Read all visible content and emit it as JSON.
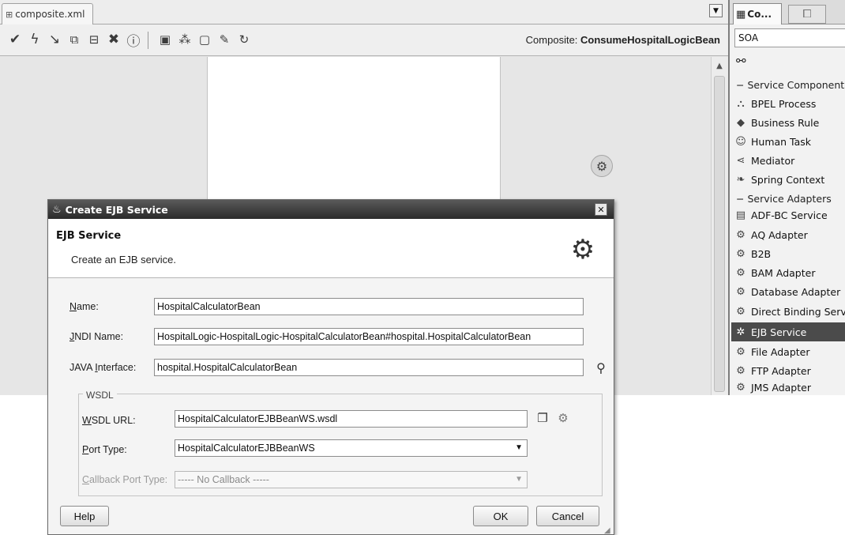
{
  "editor": {
    "tab_label": "composite.xml",
    "composite_prefix": "Composite:",
    "composite_name": "ConsumeHospitalLogicBean"
  },
  "toolbar": {
    "icons": [
      "validate-icon",
      "lightning-icon",
      "wire-icon",
      "copy-icon",
      "paste-icon",
      "delete-icon",
      "info-icon",
      "layout-icon",
      "tree-icon",
      "deploy-icon",
      "edit-icon",
      "test-icon"
    ]
  },
  "palette": {
    "tab_label": "Co...",
    "category_value": "SOA",
    "group_components": "− Service Components",
    "components": [
      {
        "label": "BPEL Process",
        "icon": "bpel-icon"
      },
      {
        "label": "Business Rule",
        "icon": "rule-icon"
      },
      {
        "label": "Human Task",
        "icon": "human-task-icon"
      },
      {
        "label": "Mediator",
        "icon": "mediator-icon"
      },
      {
        "label": "Spring Context",
        "icon": "spring-icon"
      }
    ],
    "group_adapters": "− Service Adapters",
    "adapters": [
      {
        "label": "ADF-BC Service",
        "icon": "adf-icon"
      },
      {
        "label": "AQ Adapter",
        "icon": "aq-icon"
      },
      {
        "label": "B2B",
        "icon": "b2b-icon"
      },
      {
        "label": "BAM Adapter",
        "icon": "bam-icon"
      },
      {
        "label": "Database Adapter",
        "icon": "database-icon"
      },
      {
        "label": "Direct Binding Serv",
        "icon": "binding-icon"
      },
      {
        "label": "EJB Service",
        "icon": "ejb-icon"
      },
      {
        "label": "File Adapter",
        "icon": "file-icon"
      },
      {
        "label": "FTP Adapter",
        "icon": "ftp-icon"
      },
      {
        "label": "JMS Adapter",
        "icon": "jms-icon"
      }
    ]
  },
  "dialog": {
    "title": "Create EJB Service",
    "heading": "EJB Service",
    "description": "Create an EJB service.",
    "fields": {
      "name_label_u": "N",
      "name_label_rest": "ame:",
      "name_value": "HospitalCalculatorBean",
      "jndi_label_u": "J",
      "jndi_label_rest": "NDI Name:",
      "jndi_value": "HospitalLogic-HospitalLogic-HospitalCalculatorBean#hospital.HospitalCalculatorBean",
      "java_label_pre": "JAVA ",
      "java_label_u": "I",
      "java_label_rest": "nterface:",
      "java_value": "hospital.HospitalCalculatorBean"
    },
    "wsdl": {
      "group_label": "WSDL",
      "url_label_u": "W",
      "url_label_rest": "SDL URL:",
      "url_value": "HospitalCalculatorEJBBeanWS.wsdl",
      "port_label_u": "P",
      "port_label_rest": "ort Type:",
      "port_value": "HospitalCalculatorEJBBeanWS",
      "callback_label_u": "C",
      "callback_label_rest": "allback Port Type:",
      "callback_value": "----- No Callback -----"
    },
    "buttons": {
      "help": "Help",
      "ok": "OK",
      "cancel": "Cancel"
    }
  }
}
